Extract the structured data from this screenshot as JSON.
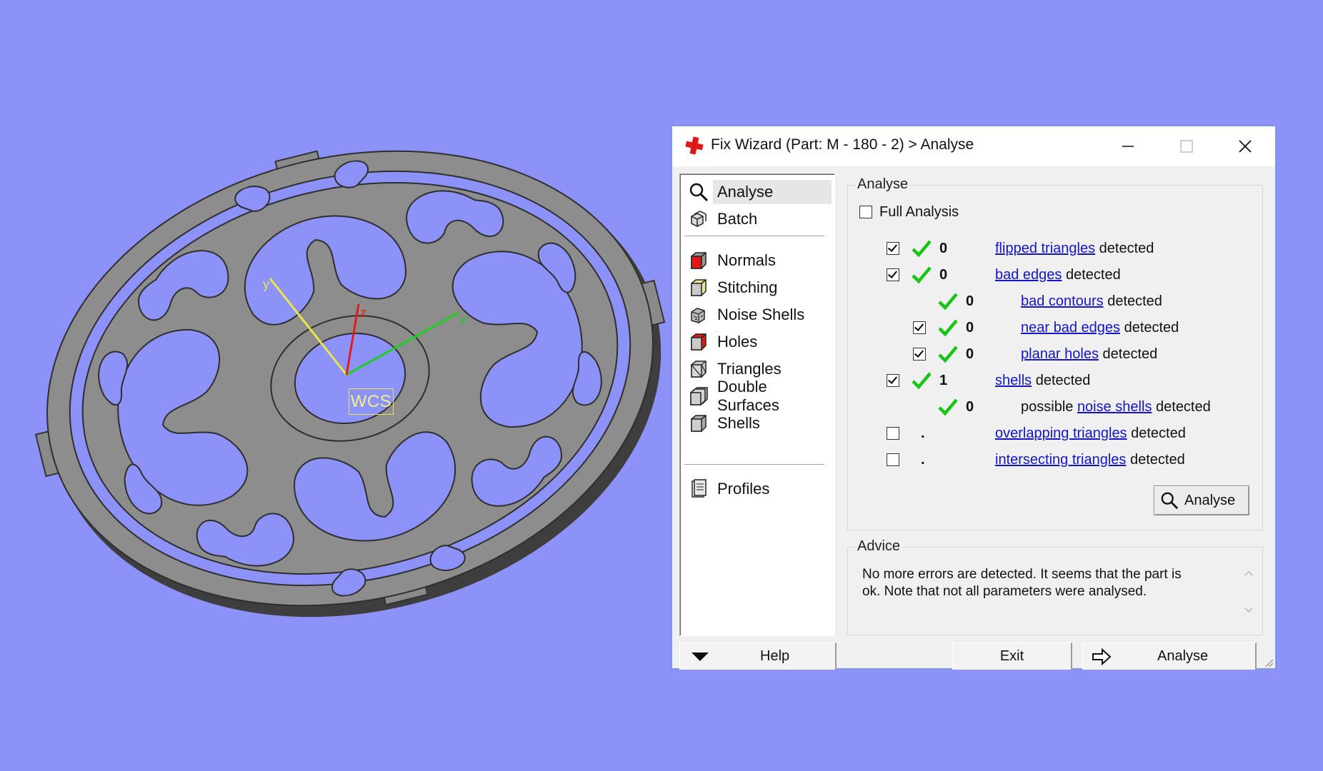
{
  "viewport": {
    "background": "#8c92f7",
    "wcs_label": "WCS",
    "axes": {
      "x_label": "x",
      "y_label": "y",
      "z_label": "z",
      "x_color": "#1ecf1e",
      "y_color": "#e8e44a",
      "z_color": "#e21b1b"
    },
    "part_color": "#8d8d8d"
  },
  "dialog": {
    "title": "Fix Wizard (Part: M - 180 - 2) > Analyse",
    "nav": {
      "group1": [
        {
          "label": "Analyse",
          "icon": "magnifier-icon",
          "selected": true
        },
        {
          "label": "Batch",
          "icon": "batch-cubes-icon"
        }
      ],
      "group2": [
        {
          "label": "Normals",
          "icon": "normals-cube-icon"
        },
        {
          "label": "Stitching",
          "icon": "stitching-cube-icon"
        },
        {
          "label": "Noise Shells",
          "icon": "noise-shells-icon"
        },
        {
          "label": "Holes",
          "icon": "holes-cube-icon"
        },
        {
          "label": "Triangles",
          "icon": "triangles-cube-icon"
        },
        {
          "label": "Double Surfaces",
          "icon": "double-surfaces-icon"
        },
        {
          "label": "Shells",
          "icon": "shells-cube-icon"
        }
      ],
      "group3": [
        {
          "label": "Profiles",
          "icon": "profiles-document-icon"
        }
      ]
    },
    "analyse_group": {
      "title": "Analyse",
      "full_analysis": {
        "label": "Full Analysis",
        "checked": false
      },
      "rows": [
        {
          "checked": true,
          "status": "ok",
          "count": "0",
          "link": "flipped triangles",
          "suffix": " detected",
          "indent": 0
        },
        {
          "checked": true,
          "status": "ok",
          "count": "0",
          "link": "bad edges",
          "suffix": " detected",
          "indent": 0
        },
        {
          "checked": null,
          "status": "ok",
          "count": "0",
          "link": "bad contours",
          "suffix": " detected",
          "indent": 1
        },
        {
          "checked": true,
          "status": "ok",
          "count": "0",
          "link": "near bad edges",
          "suffix": " detected",
          "indent": 1
        },
        {
          "checked": true,
          "status": "ok",
          "count": "0",
          "link": "planar holes",
          "suffix": " detected",
          "indent": 1
        },
        {
          "checked": true,
          "status": "ok",
          "count": "1",
          "link": "shells",
          "suffix": " detected",
          "indent": 0
        },
        {
          "checked": null,
          "status": "ok",
          "count": "0",
          "prefix": "possible ",
          "link": "noise shells",
          "suffix": " detected",
          "indent": 1
        },
        {
          "checked": false,
          "status": "none",
          "count": ".",
          "link": "overlapping triangles",
          "suffix": " detected",
          "indent": 0
        },
        {
          "checked": false,
          "status": "none",
          "count": ".",
          "link": "intersecting triangles",
          "suffix": " detected",
          "indent": 0
        }
      ],
      "analyse_button": "Analyse"
    },
    "advice_group": {
      "title": "Advice",
      "text": "No more errors are detected. It seems that the part is ok. Note that not all parameters were analysed."
    },
    "buttons": {
      "help": "Help",
      "exit": "Exit",
      "analyse": "Analyse"
    },
    "colors": {
      "tick": "#16c516",
      "link": "#1515c8",
      "title_icon": "#e01818"
    }
  }
}
